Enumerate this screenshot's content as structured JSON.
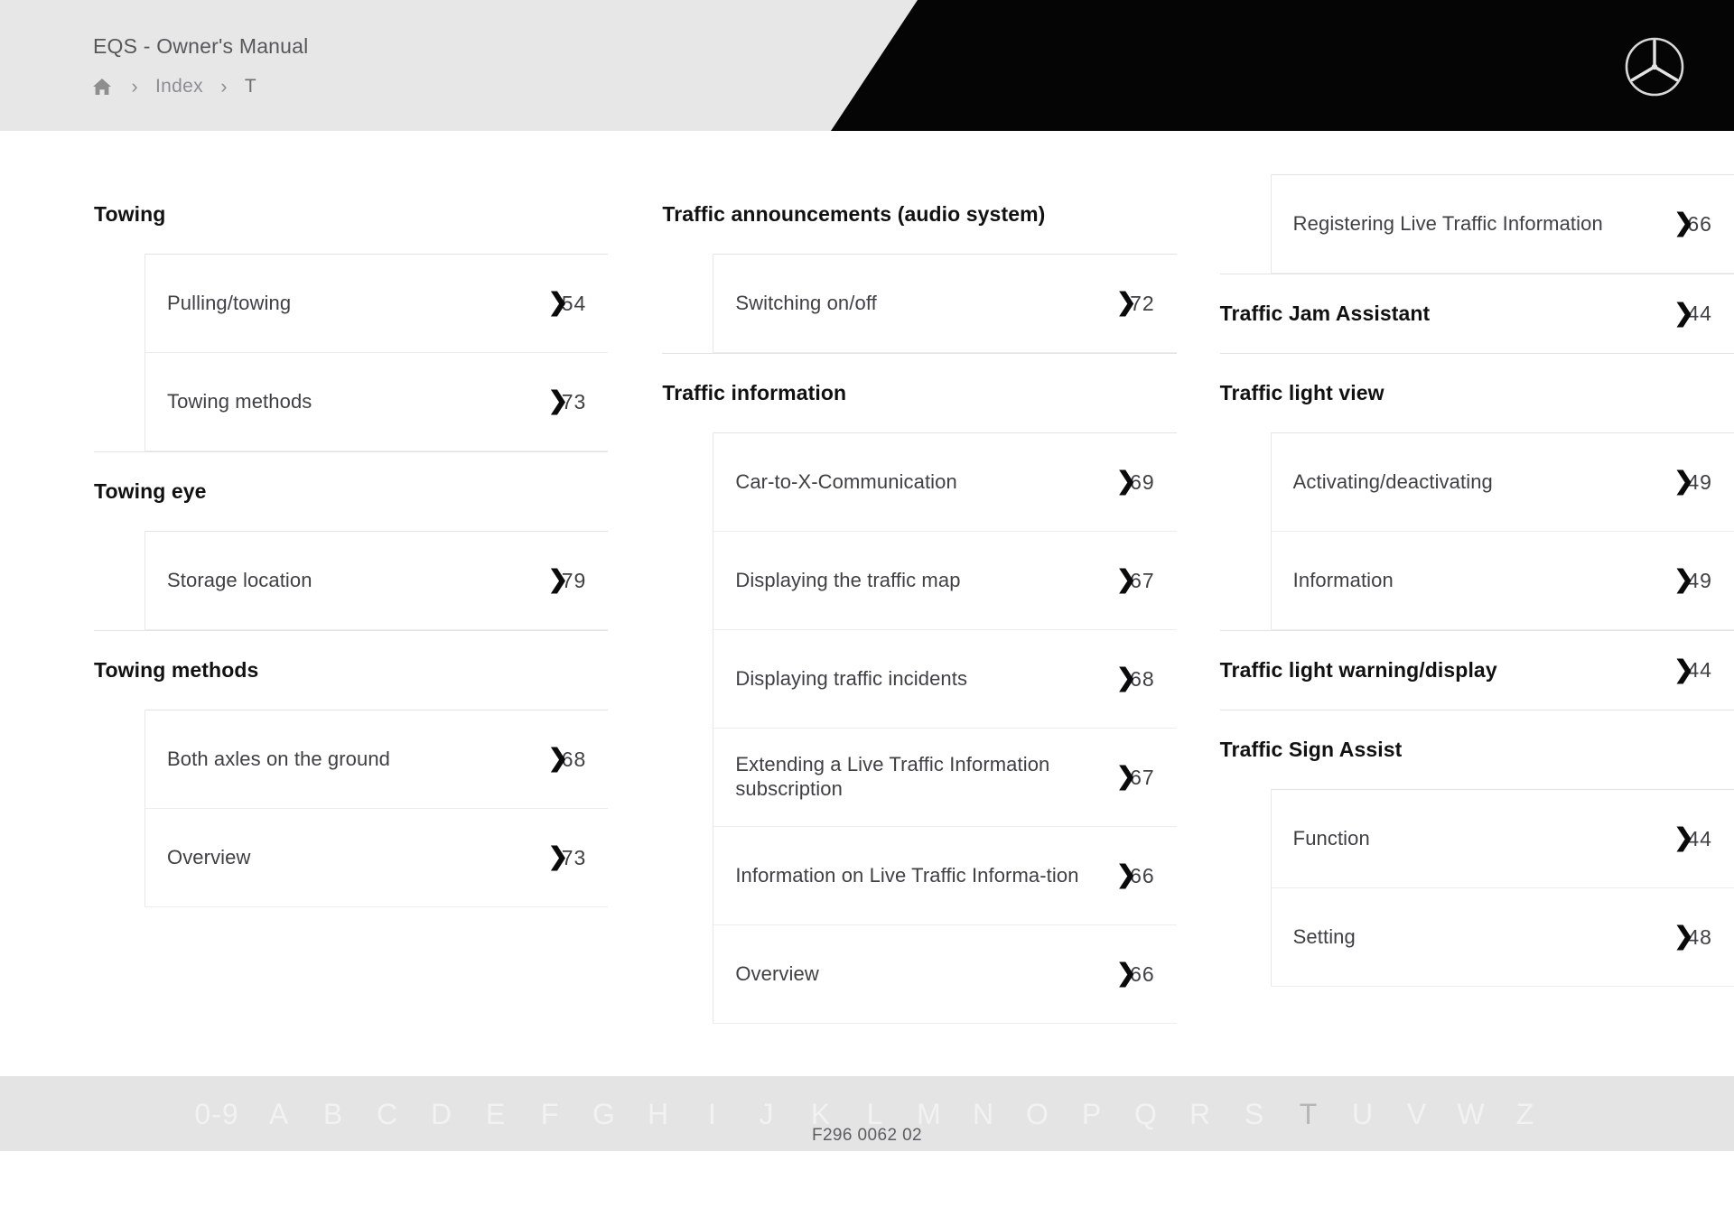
{
  "header": {
    "title": "EQS - Owner's Manual",
    "breadcrumb": {
      "home_icon": "home-icon",
      "separator": "›",
      "index_label": "Index",
      "current_label": "T"
    },
    "logo": "mercedes-benz-star-logo",
    "colors": {
      "bar": "#e7e7e7",
      "panel": "#050505"
    }
  },
  "columns": [
    {
      "groups": [
        {
          "title": "Towing",
          "page": null,
          "first": true,
          "entries": [
            {
              "title": "Pulling/towing",
              "page": "5»4"
            },
            {
              "title": "Towing methods",
              "page": "7»3"
            }
          ]
        },
        {
          "title": "Towing eye",
          "page": null,
          "first": false,
          "entries": [
            {
              "title": "Storage location",
              "page": "7»9"
            }
          ]
        },
        {
          "title": "Towing methods",
          "page": null,
          "first": false,
          "entries": [
            {
              "title": "Both axles on the ground",
              "page": "6»8"
            },
            {
              "title": "Overview",
              "page": "7»3"
            }
          ]
        }
      ]
    },
    {
      "groups": [
        {
          "title": "Traffic announcements (audio system)",
          "page": null,
          "first": true,
          "entries": [
            {
              "title": "Switching on/off",
              "page": "7»2"
            }
          ]
        },
        {
          "title": "Traffic information",
          "page": null,
          "first": false,
          "entries": [
            {
              "title": "Car-to-X-Communication",
              "page": "6»9"
            },
            {
              "title": "Displaying the traffic map",
              "page": "6»7"
            },
            {
              "title": "Displaying traffic incidents",
              "page": "6»8"
            },
            {
              "title": "Extending a Live Traffic Information subscription",
              "page": "6»7"
            },
            {
              "title": "Information on Live Traffic Informa-tion",
              "page": "6»6"
            },
            {
              "title": "Overview",
              "page": "6»6"
            }
          ]
        }
      ]
    },
    {
      "groups": [
        {
          "title": null,
          "page": null,
          "first": true,
          "entries": [
            {
              "title": "Registering Live Traffic Information",
              "page": "6»6"
            }
          ]
        },
        {
          "title": "Traffic Jam Assistant",
          "page": "4»4",
          "first": false,
          "entries": []
        },
        {
          "title": "Traffic light view",
          "page": null,
          "first": false,
          "entries": [
            {
              "title": "Activating/deactivating",
              "page": "4»9"
            },
            {
              "title": "Information",
              "page": "4»9"
            }
          ]
        },
        {
          "title": "Traffic light warning/display",
          "page": "4»4",
          "first": false,
          "entries": []
        },
        {
          "title": "Traffic Sign Assist",
          "page": null,
          "first": false,
          "entries": [
            {
              "title": "Function",
              "page": "4»4"
            },
            {
              "title": "Setting",
              "page": "4»8"
            }
          ]
        }
      ]
    }
  ],
  "alphabar": {
    "letters": [
      "0-9",
      "A",
      "B",
      "C",
      "D",
      "E",
      "F",
      "G",
      "H",
      "I",
      "J",
      "K",
      "L",
      "M",
      "N",
      "O",
      "P",
      "Q",
      "R",
      "S",
      "T",
      "U",
      "V",
      "W",
      "Z"
    ],
    "active": "T"
  },
  "footer": {
    "code": "F296 0062 02"
  }
}
